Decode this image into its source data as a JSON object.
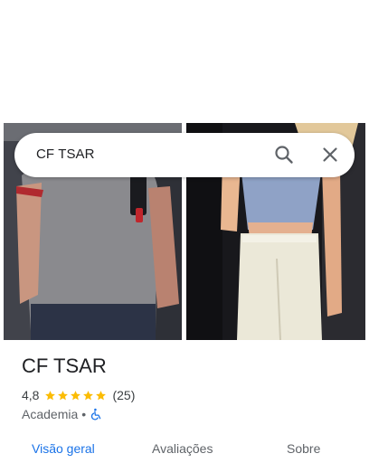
{
  "search": {
    "query": "CF TSAR"
  },
  "place": {
    "name": "CF TSAR",
    "rating": "4,8",
    "stars": 5,
    "review_count": "(25)",
    "category": "Academia",
    "separator": "•"
  },
  "tabs": [
    {
      "label": "Visão geral",
      "active": true
    },
    {
      "label": "Avaliações",
      "active": false
    },
    {
      "label": "Sobre",
      "active": false
    }
  ],
  "colors": {
    "accent": "#1a73e8",
    "star": "#fbbc04",
    "text_primary": "#202124",
    "text_secondary": "#5f6368"
  },
  "icons": {
    "search": "search-icon",
    "close": "close-icon",
    "star": "star-icon",
    "accessibility": "wheelchair-accessible-icon"
  }
}
